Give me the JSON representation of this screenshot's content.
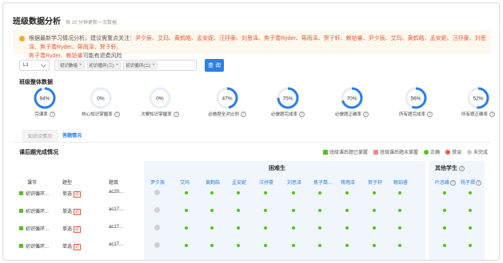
{
  "header": {
    "title": "班级数据分析",
    "subtitle": "每 10 分钟更新一次数据"
  },
  "notice": {
    "prefix": "根据最新学习情况分析，建议需重点关注：",
    "names": "尹夕辰、艾玛、黄鹤皓、孟安妮、汪抒豪、刘思泽、焦子喬Ryder、蒋雨泽、贺子轩、赖铂睿、尹夕辰、艾玛、黄鹤皓、孟安妮、汪抒豪、刘思泽、焦子喬Ryder、蒋雨泽、贺子轩、",
    "names2": "焦子喬Ryder、赖铂睿",
    "suffix": "可能有退费风险"
  },
  "filters": {
    "level_value": "L1",
    "tags": [
      "初识数组",
      "初识循环(三)",
      "初识循环(二)"
    ],
    "query_label": "查 询"
  },
  "overview": {
    "title": "班级整体数据",
    "stats": [
      {
        "value": "94%",
        "percent": 94,
        "label": "完课率",
        "help": true
      },
      {
        "value": "0%",
        "percent": 0,
        "label": "核心知识掌握率",
        "help": true
      },
      {
        "value": "0%",
        "percent": 0,
        "label": "次要知识掌握率",
        "help": true
      },
      {
        "value": "47%",
        "percent": 47,
        "label": "必做题全对比例",
        "help": true
      },
      {
        "value": "75%",
        "percent": 75,
        "label": "必做题完成率",
        "help": true
      },
      {
        "value": "70%",
        "percent": 70,
        "label": "必做题正确率",
        "help": true
      },
      {
        "value": "56%",
        "percent": 56,
        "label": "所有题完成率",
        "help": true
      },
      {
        "value": "52%",
        "percent": 52,
        "label": "所有题正确率",
        "help": true
      }
    ]
  },
  "tabs": [
    {
      "label": "知识点情况",
      "active": false
    },
    {
      "label": "答题情况",
      "active": true
    }
  ],
  "completion": {
    "title": "课后题完成情况",
    "legend": [
      {
        "label": "班级课后题已掌握",
        "color": "#52c41a",
        "shape": "square"
      },
      {
        "label": "班级课后题未掌握",
        "color": "#f08a8a",
        "shape": "square"
      },
      {
        "label": "正确",
        "color": "#52c41a",
        "shape": "circle"
      },
      {
        "label": "错误",
        "color": "#f05a4a",
        "shape": "circle"
      },
      {
        "label": "未完成",
        "color": "#cccccc",
        "shape": "circle"
      }
    ],
    "group_graduate": "困难生",
    "group_other": "其他学生",
    "col_headers": {
      "section": "课节",
      "type": "题型",
      "question": "题目"
    },
    "students": [
      "尹夕辰",
      "艾玛",
      "黄鹤皓",
      "孟安妮",
      "汪抒豪",
      "刘思泽",
      "焦子喬...",
      "蒋雨泽",
      "贺子轩",
      "赖铂睿"
    ],
    "other_students": [
      "叶忞峰",
      "杨子熠"
    ],
    "rows": [
      {
        "section": "初识循环...",
        "type": "单选",
        "badge": "必",
        "question": "ac20...",
        "statuses": [
          "n",
          "c",
          "c",
          "c",
          "c",
          "c",
          "c",
          "c",
          "c",
          "c"
        ],
        "other": [
          "c",
          "c"
        ]
      },
      {
        "section": "初识循环...",
        "type": "单选",
        "badge": "必",
        "question": "ac17...",
        "statuses": [
          "n",
          "c",
          "c",
          "c",
          "c",
          "c",
          "c",
          "c",
          "c",
          "c"
        ],
        "other": [
          "c",
          "c"
        ]
      },
      {
        "section": "初识循环...",
        "type": "单选",
        "badge": "必",
        "question": "ac17...",
        "statuses": [
          "n",
          "c",
          "c",
          "c",
          "c",
          "c",
          "c",
          "c",
          "c",
          "c"
        ],
        "other": [
          "c",
          "c"
        ]
      },
      {
        "section": "初识循环...",
        "type": "单选",
        "badge": "必",
        "question": "ac17...",
        "statuses": [
          "n",
          "c",
          "c",
          "c",
          "c",
          "c",
          "c",
          "c",
          "c",
          "c"
        ],
        "other": [
          "c",
          "c"
        ]
      }
    ]
  },
  "colors": {
    "accent": "#2b7fe6",
    "correct": "#52c41a",
    "not_done": "#d0d0d0",
    "warning_names": "#e85a3a"
  }
}
